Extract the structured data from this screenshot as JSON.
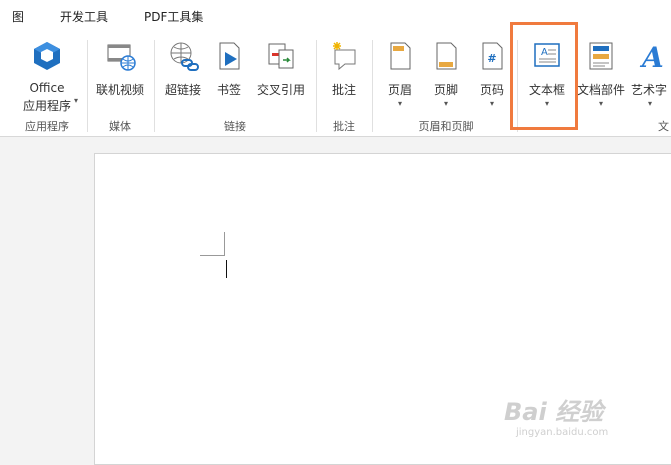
{
  "menubar": {
    "items": [
      "图",
      "开发工具",
      "PDF工具集"
    ]
  },
  "ribbon": {
    "buttons": {
      "office_line1": "Office",
      "office_line2": "应用程序",
      "online_video": "联机视频",
      "hyperlink": "超链接",
      "bookmark": "书签",
      "cross_ref": "交叉引用",
      "comment": "批注",
      "header": "页眉",
      "footer": "页脚",
      "page_number": "页码",
      "text_box": "文本框",
      "quick_parts": "文档部件",
      "wordart": "艺术字"
    },
    "groups": {
      "apps": "应用程序",
      "media": "媒体",
      "links": "链接",
      "comments": "批注",
      "header_footer": "页眉和页脚",
      "text": "文"
    }
  },
  "watermark": {
    "brand": "Bai 经验",
    "url": "jingyan.baidu.com"
  },
  "colors": {
    "highlight": "#f07a3e",
    "office_blue": "#1f6fbf"
  }
}
